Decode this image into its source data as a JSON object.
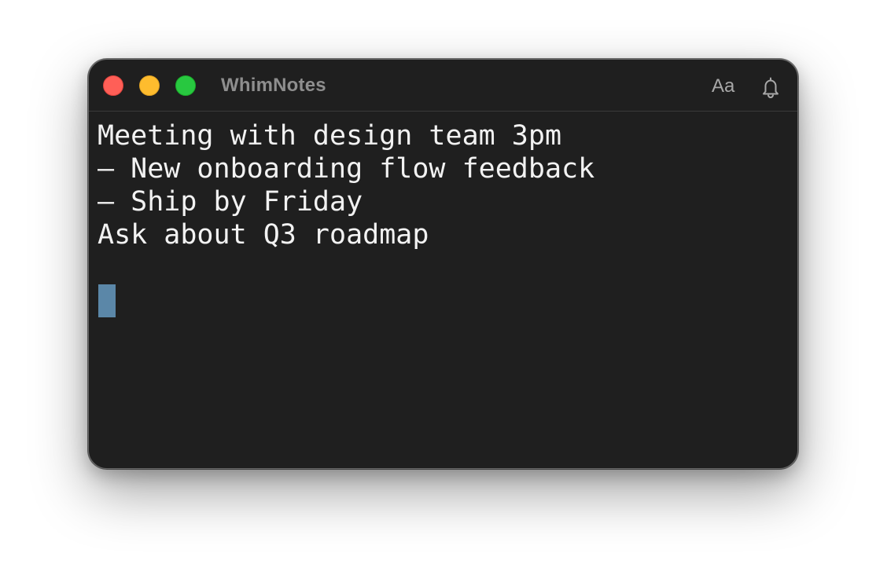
{
  "window": {
    "title": "WhimNotes",
    "traffic_lights": {
      "close": {
        "color": "#ff5f57",
        "border": "#e0443e"
      },
      "minimize": {
        "color": "#febc2e",
        "border": "#dea123"
      },
      "maximize": {
        "color": "#28c840",
        "border": "#1aab29"
      }
    }
  },
  "toolbar": {
    "font_button_label": "Aa",
    "font_icon": "font-size-icon",
    "bell_icon": "bell-icon"
  },
  "editor": {
    "lines": [
      "Meeting with design team 3pm",
      "– New onboarding flow feedback",
      "– Ship by Friday",
      "Ask about Q3 roadmap",
      ""
    ],
    "cursor_color": "#5b87a8"
  },
  "colors": {
    "window_bg": "#1f1f1f",
    "text": "#f2f2f2",
    "title_text": "#8e8e8e",
    "icon": "#a8a8a8"
  }
}
